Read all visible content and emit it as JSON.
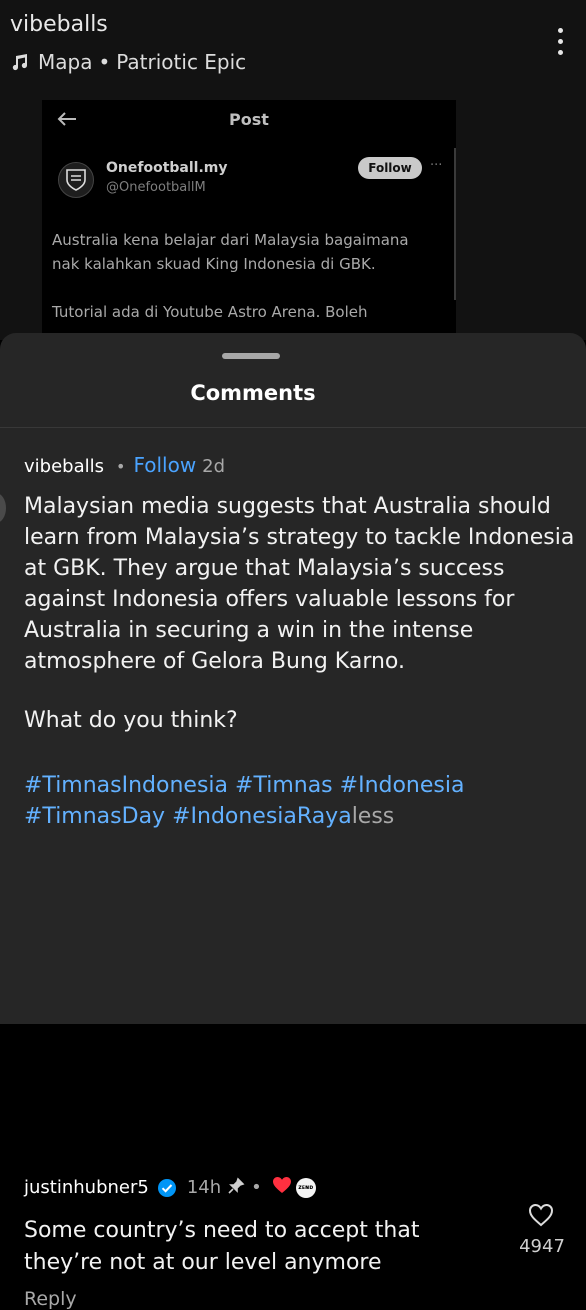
{
  "reel": {
    "username": "vibeballs",
    "music_artist": "Mapa",
    "music_separator": "•",
    "music_title": "Patriotic Epic",
    "more_icon": "kebab-vertical-icon"
  },
  "embedded_post": {
    "header_title": "Post",
    "back_icon": "arrow-left-icon",
    "account_name": "Onefootball.my",
    "account_handle": "@OnefootballM",
    "follow_label": "Follow",
    "more_label": "···",
    "text": "Australia kena belajar dari Malaysia bagaimana\nnak kalahkan skuad King Indonesia di GBK.\n\nTutorial ada di Youtube Astro Arena. Boleh"
  },
  "comments_sheet": {
    "title": "Comments",
    "comments": [
      {
        "username": "vibeballs",
        "separator": "•",
        "follow_label": "Follow",
        "time": "2d",
        "body": "Malaysian media suggests that Australia should learn from Malaysia’s strategy to tackle Indonesia at GBK. They argue that Malaysia’s success against Indonesia offers valuable lessons for Australia in securing a win in the intense atmosphere of Gelora Bung Karno.",
        "question": "What do you think?",
        "hashtags": [
          "#TimnasIndonesia",
          "#Timnas",
          "#Indonesia",
          "#TimnasDay",
          "#IndonesiaRaya"
        ],
        "less_label": "less"
      },
      {
        "username": "justinhubner5",
        "verified": true,
        "time": "14h",
        "separator": "•",
        "pinned_icon": "pin-icon",
        "creator_liked_icon": "red-heart-icon",
        "creator_avatar_text": "ᴢᴇɴᴅ",
        "body": "Some country’s need to accept that they’re not at our level anymore",
        "reply_label": "Reply",
        "like_count": "4947",
        "like_icon": "heart-outline-icon"
      }
    ]
  },
  "colors": {
    "sheet_bg": "#262626",
    "link_blue": "#4aa3ff",
    "hashtag_blue": "#63b1ff",
    "verified_blue": "#0095f6",
    "heart_red": "#ff3040"
  }
}
